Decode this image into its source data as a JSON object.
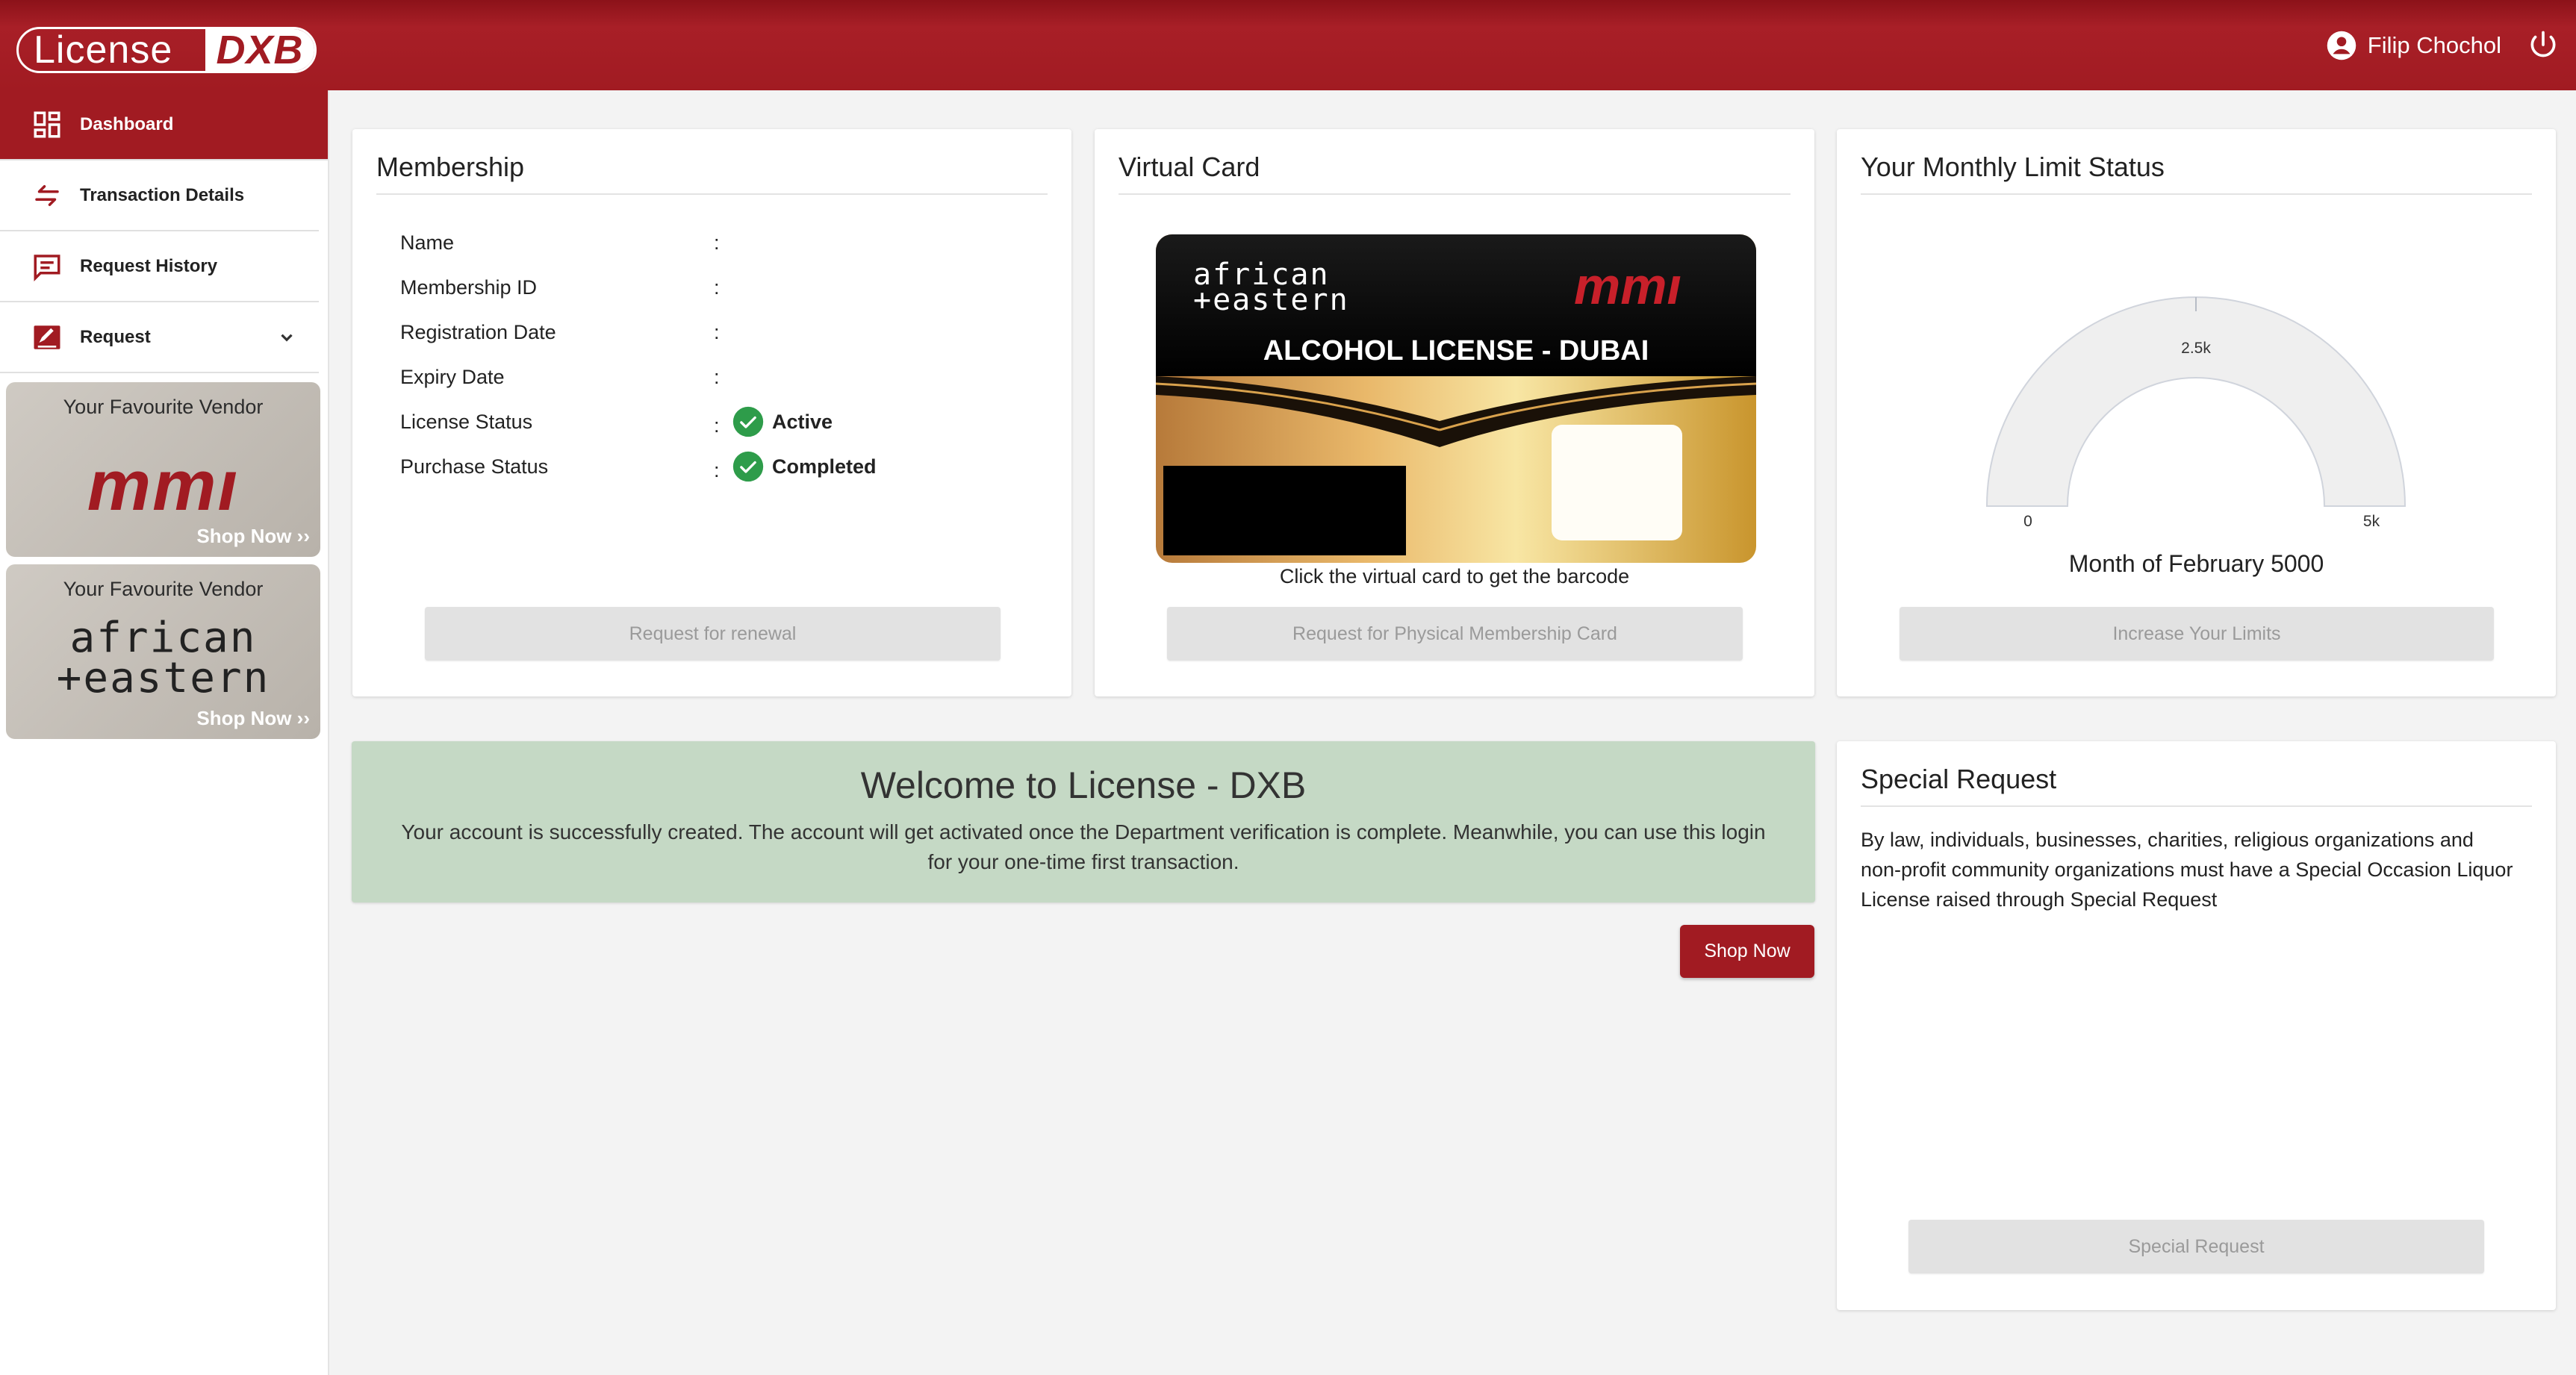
{
  "header": {
    "logo_left": "License",
    "logo_right": "DXB",
    "user_name": "Filip Chochol"
  },
  "sidebar": {
    "items": [
      {
        "label": "Dashboard"
      },
      {
        "label": "Transaction Details"
      },
      {
        "label": "Request History"
      },
      {
        "label": "Request"
      }
    ],
    "vendors": [
      {
        "title": "Your Favourite Vendor",
        "logo": "mmı",
        "shop": "Shop Now ››"
      },
      {
        "title": "Your Favourite Vendor",
        "logo_line1": "african",
        "logo_line2": "+eastern",
        "shop": "Shop Now ››"
      }
    ]
  },
  "membership": {
    "title": "Membership",
    "rows": [
      {
        "label": "Name",
        "colon": ":",
        "value": ""
      },
      {
        "label": "Membership ID",
        "colon": ":",
        "value": ""
      },
      {
        "label": "Registration Date",
        "colon": ":",
        "value": ""
      },
      {
        "label": "Expiry Date",
        "colon": ":",
        "value": ""
      },
      {
        "label": "License Status",
        "colon": ":",
        "value": "Active"
      },
      {
        "label": "Purchase Status",
        "colon": ":",
        "value": "Completed"
      }
    ],
    "button": "Request for renewal"
  },
  "virtual_card": {
    "title": "Virtual Card",
    "brand_left_1": "african",
    "brand_left_2": "+eastern",
    "brand_right": "mmı",
    "card_heading": "ALCOHOL LICENSE - DUBAI",
    "caption": "Click the virtual card to get the barcode",
    "button": "Request for Physical Membership Card"
  },
  "limit": {
    "title": "Your Monthly Limit Status",
    "gauge_min": "0",
    "gauge_mid": "2.5k",
    "gauge_max": "5k",
    "gauge_value": 0,
    "caption": "Month of February 5000",
    "button": "Increase Your Limits"
  },
  "welcome": {
    "title": "Welcome to License - DXB",
    "text": "Your account is successfully created. The account will get activated once the Department verification is complete. Meanwhile, you can use this login for your one-time first transaction."
  },
  "shop_now": "Shop Now",
  "special": {
    "title": "Special Request",
    "text": "By law, individuals, businesses, charities, religious organizations and non-profit community organizations must have a Special Occasion Liquor License raised through Special Request",
    "button": "Special Request"
  },
  "colors": {
    "brand": "#a11b22",
    "success": "#2e9c4a",
    "welcome_bg": "#c5d9c5"
  }
}
